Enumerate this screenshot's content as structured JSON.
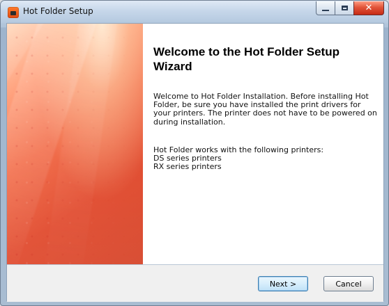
{
  "window": {
    "title": "Hot Folder Setup",
    "controls": {
      "minimize_icon": "minimize-icon",
      "maximize_icon": "maximize-icon",
      "close_icon": "close-icon"
    }
  },
  "wizard": {
    "heading": "Welcome to the Hot Folder Setup Wizard",
    "intro": "Welcome to Hot Folder Installation. Before installing Hot Folder, be sure you have installed the print drivers for your printers. The printer does not have to be powered on during installation.",
    "printers_intro": "Hot Folder works with the following printers:",
    "printers": [
      "DS series printers",
      "RX series printers"
    ]
  },
  "footer": {
    "next_label": "Next >",
    "cancel_label": "Cancel"
  },
  "colors": {
    "accent": "#d54024",
    "button_border": "#6d7d8f",
    "close_button": "#c62b15"
  }
}
